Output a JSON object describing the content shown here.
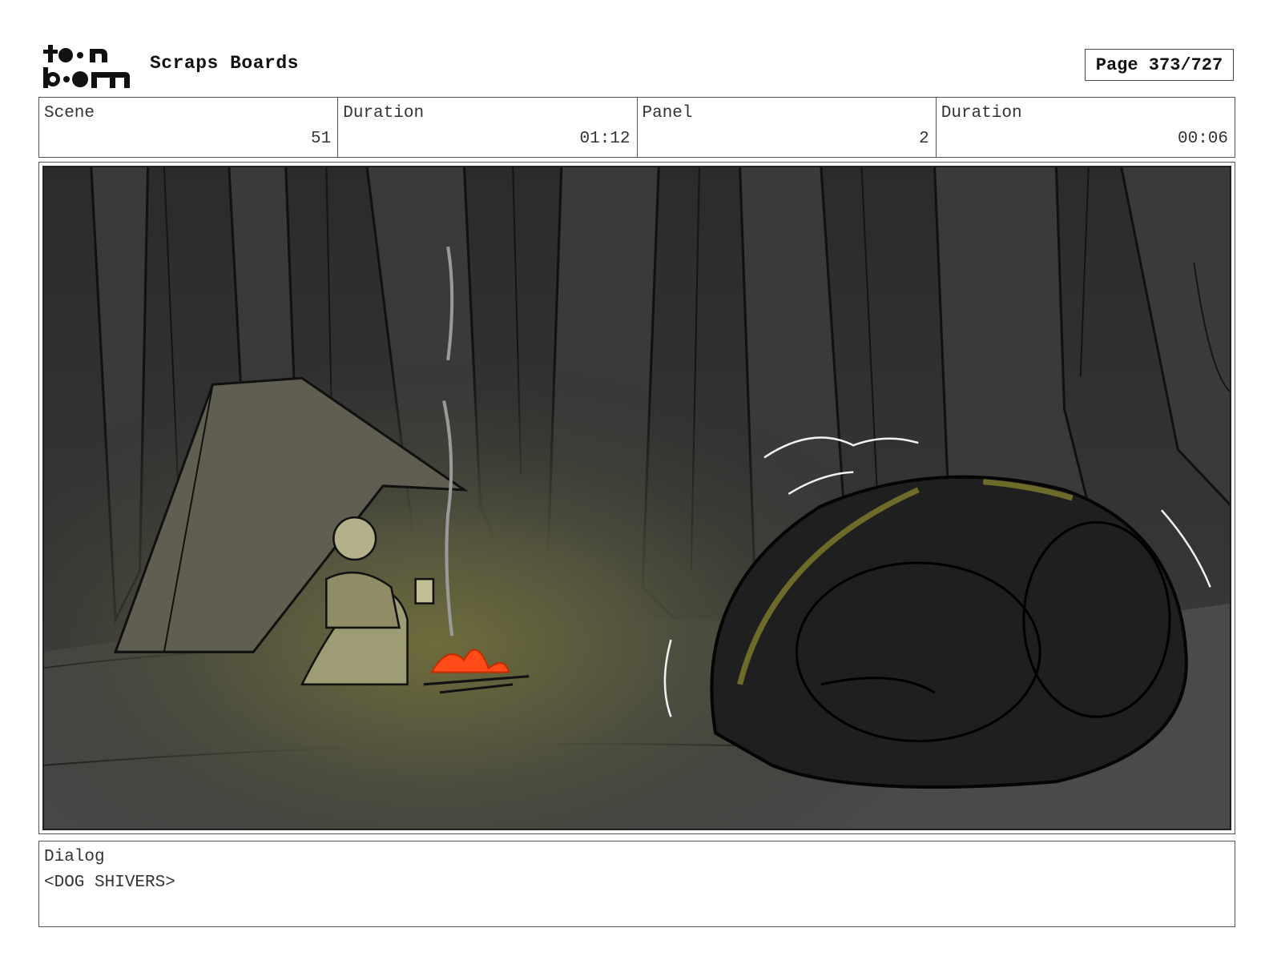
{
  "header": {
    "logo_text": "toon boom",
    "title": "Scraps Boards",
    "page_label": "Page 373/727"
  },
  "info": {
    "scene_label": "Scene",
    "scene_value": "51",
    "scene_duration_label": "Duration",
    "scene_duration_value": "01:12",
    "panel_label": "Panel",
    "panel_value": "2",
    "panel_duration_label": "Duration",
    "panel_duration_value": "00:06"
  },
  "dialog": {
    "label": "Dialog",
    "text": "<DOG SHIVERS>"
  },
  "colors": {
    "background": "#ffffff",
    "border": "#555555",
    "forest_dark": "#2e2e2e",
    "fire_glow": "#6b6a3a",
    "fire": "#ff4a1a"
  }
}
